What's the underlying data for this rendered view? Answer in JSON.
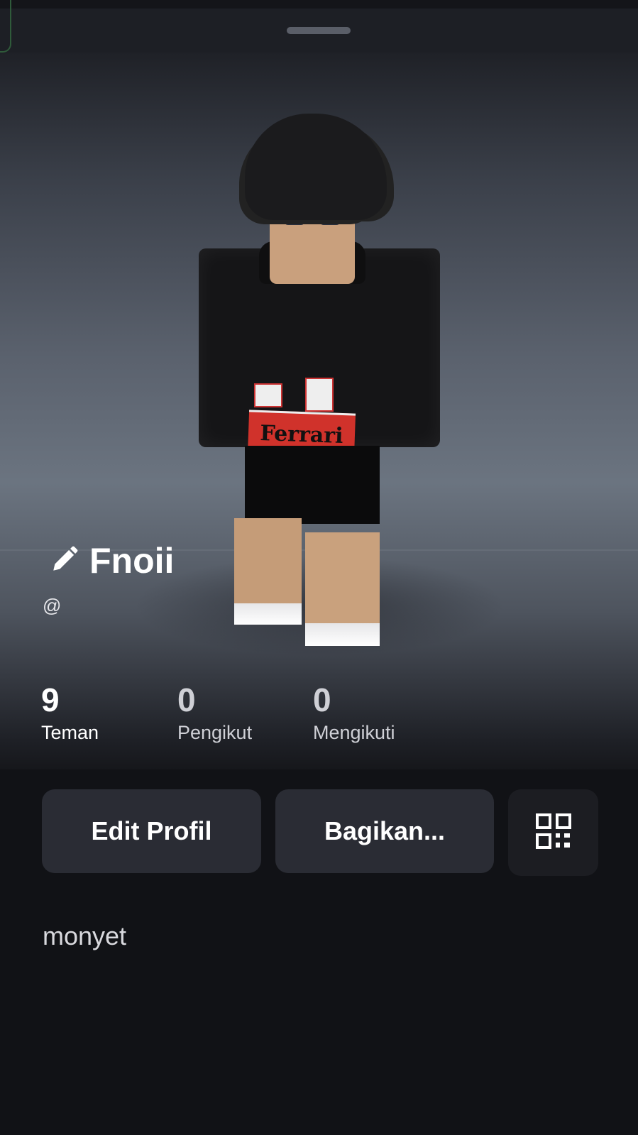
{
  "profile": {
    "display_name": "Fnoii",
    "handle": "@",
    "bio": "monyet"
  },
  "stats": [
    {
      "value": "9",
      "label": "Teman"
    },
    {
      "value": "0",
      "label": "Pengikut"
    },
    {
      "value": "0",
      "label": "Mengikuti"
    }
  ],
  "actions": {
    "edit_label": "Edit Profil",
    "share_label": "Bagikan..."
  },
  "avatar": {
    "shirt_text": "Ferrari"
  },
  "icons": {
    "edit": "pencil-icon",
    "qr": "qr-code-icon"
  },
  "colors": {
    "background": "#111216",
    "button": "#2a2c34",
    "text": "#ffffff"
  }
}
